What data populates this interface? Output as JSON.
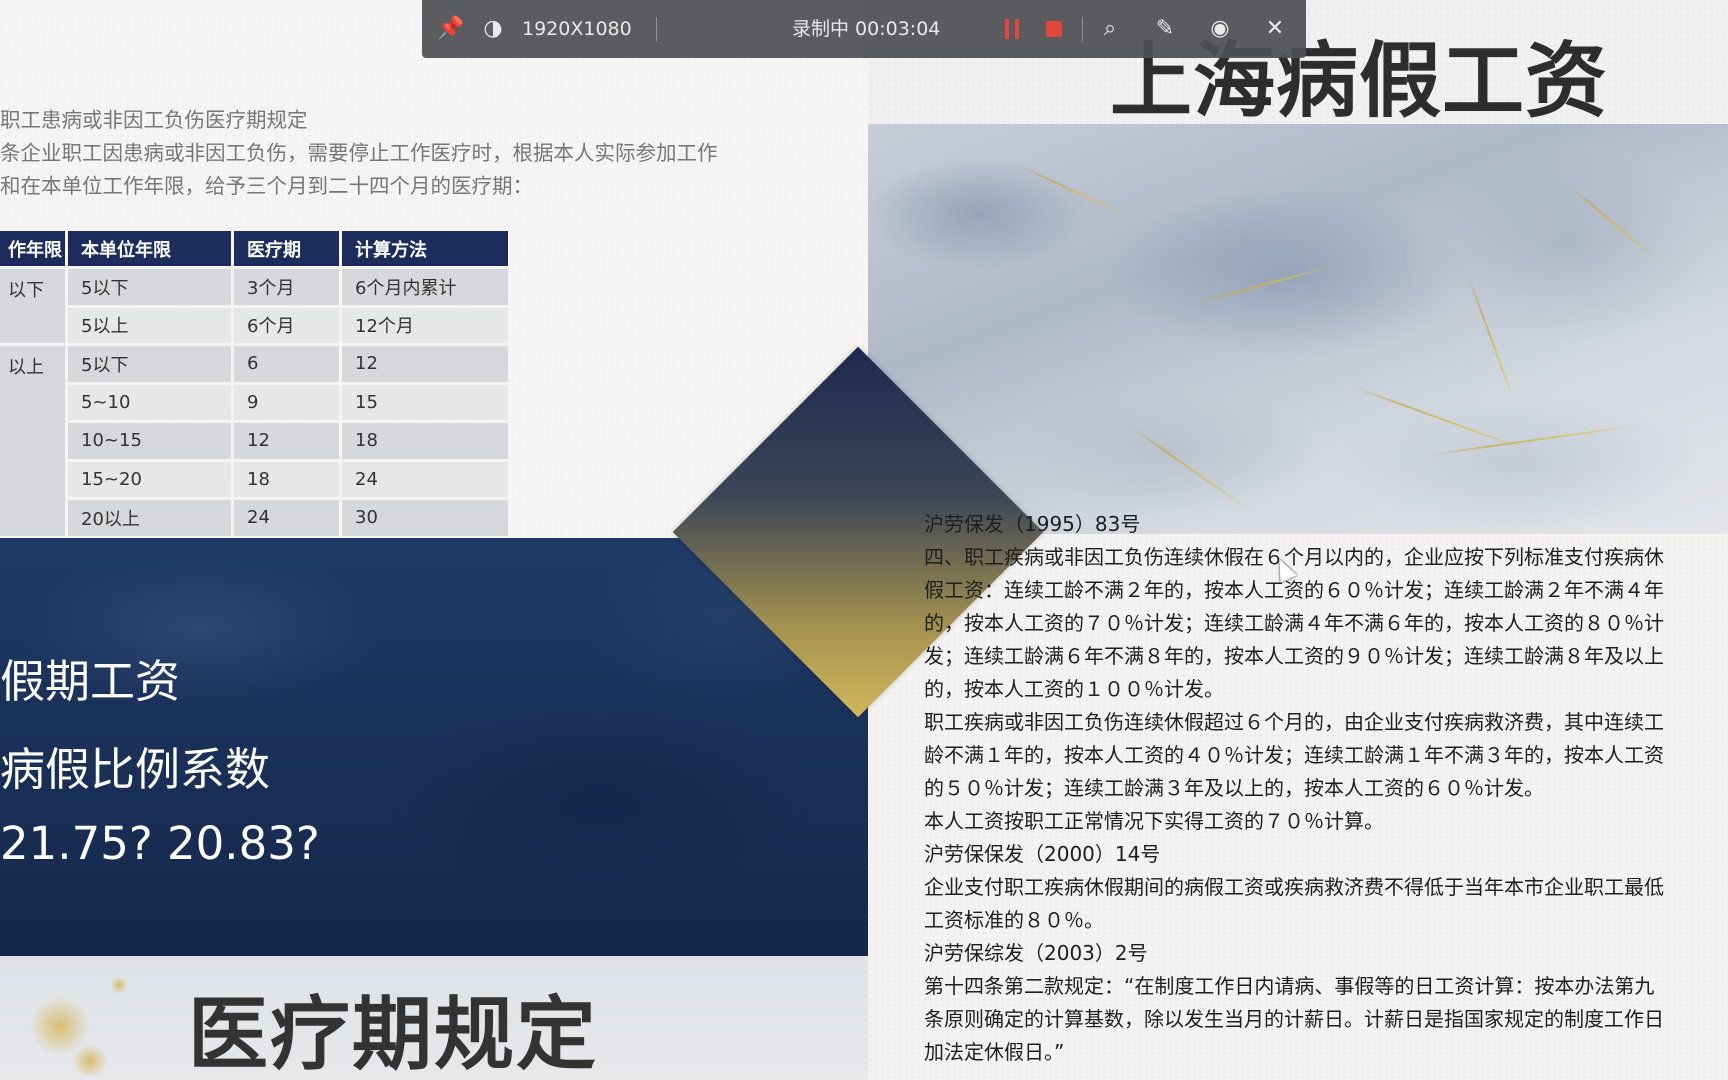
{
  "toolbar": {
    "resolution": "1920X1080",
    "status": "录制中 00:03:04",
    "icons": [
      "pin-icon",
      "contrast-icon",
      "pause-icon",
      "stop-icon",
      "magnifier-icon",
      "pen-icon",
      "camera-icon",
      "close-icon"
    ],
    "accent_color": "#e2463c"
  },
  "left_top": {
    "heading": "职工患病或非因工负伤医疗期规定",
    "paragraph_line1": "条企业职工因患病或非因工负伤，需要停止工作医疗时，根据本人实际参加工作",
    "paragraph_line2": "和在本单位工作年限，给予三个月到二十四个月的医疗期：",
    "table": {
      "headers": [
        "作年限",
        "本单位年限",
        "医疗期",
        "计算方法"
      ],
      "group1_label": "以下",
      "group2_label": "以上",
      "rows": [
        [
          "5以下",
          "3个月",
          "6个月内累计"
        ],
        [
          "5以上",
          "6个月",
          "12个月"
        ],
        [
          "5以下",
          "6",
          "12"
        ],
        [
          "5~10",
          "9",
          "15"
        ],
        [
          "10~15",
          "12",
          "18"
        ],
        [
          "15~20",
          "18",
          "24"
        ],
        [
          "20以上",
          "24",
          "30"
        ]
      ],
      "header_color": "#1c2c5c"
    }
  },
  "navy_block": {
    "line1": "假期工资",
    "line2": "病假比例系数",
    "line3": "21.75?  20.83?"
  },
  "bottom_title": "医疗期规定",
  "right_title": "上海病假工资",
  "regulation_lines": [
    "沪劳保发（1995）83号",
    "四、职工疾病或非因工负伤连续休假在６个月以内的，企业应按下列标准支付疾病休",
    "假工资：连续工龄不满２年的，按本人工资的６０％计发；连续工龄满２年不满４年",
    "的，按本人工资的７０％计发；连续工龄满４年不满６年的，按本人工资的８０％计",
    "发；连续工龄满６年不满８年的，按本人工资的９０％计发；连续工龄满８年及以上",
    "的，按本人工资的１００％计发。",
    "职工疾病或非因工负伤连续休假超过６个月的，由企业支付疾病救济费，其中连续工",
    "龄不满１年的，按本人工资的４０％计发；连续工龄满１年不满３年的，按本人工资",
    "的５０％计发；连续工龄满３年及以上的，按本人工资的６０％计发。",
    "本人工资按职工正常情况下实得工资的７０％计算。",
    "沪劳保保发（2000）14号",
    "企业支付职工疾病休假期间的病假工资或疾病救济费不得低于当年本市企业职工最低",
    "工资标准的８０％。",
    "沪劳保综发（2003）2号",
    "第十四条第二款规定：“在制度工作日内请病、事假等的日工资计算：按本办法第九",
    "条原则确定的计算基数，除以发生当月的计薪日。计薪日是指国家规定的制度工作日",
    "加法定休假日。”"
  ]
}
